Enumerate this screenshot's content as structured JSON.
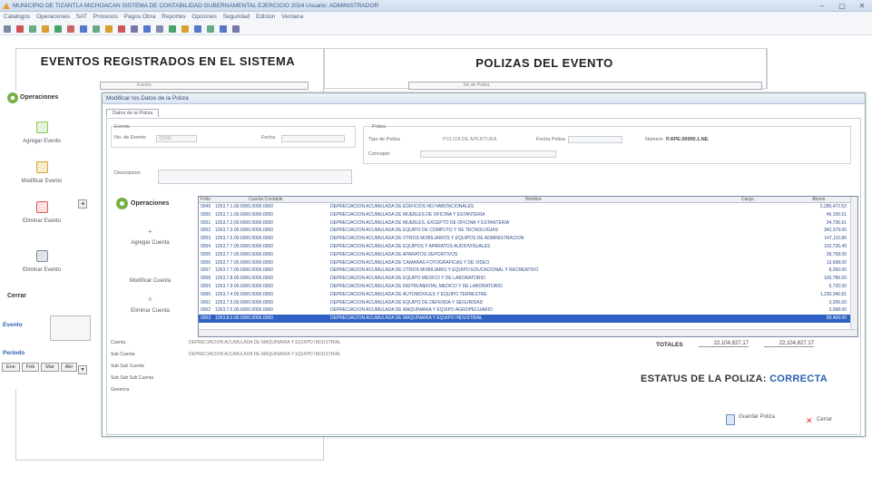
{
  "window": {
    "title": "MUNICIPIO DE TIZANTLA MICHOACAN SISTEMA DE CONTABILIDAD GUBERNAMENTAL EJERCICIO 2024 Usuario: ADMINISTRADOR",
    "controls": [
      "‒",
      "▢",
      "✕"
    ]
  },
  "menu": [
    "Catalogos",
    "Operaciones",
    "SAT",
    "Procesos",
    "Pagos Obra",
    "Reportes",
    "Opciones",
    "Seguridad",
    "Edicion",
    "Ventana"
  ],
  "toolbar_colors": [
    "#7a8aa0",
    "#c55",
    "#6a8",
    "#d8a030",
    "#4aa36a",
    "#c66",
    "#5577cc",
    "#6a8",
    "#d8a030",
    "#c55",
    "#77a",
    "#5577cc",
    "#88a",
    "#4aa36a",
    "#d8a030",
    "#5577cc",
    "#6a8",
    "#5577cc",
    "#77a"
  ],
  "background": {
    "left_header": "EVENTOS REGISTRADOS EN EL SISTEMA",
    "right_header": "POLIZAS DEL EVENTO",
    "combo_left": "Evento",
    "combo_right": "No de Poliza",
    "sidebar": {
      "title": "Operaciones",
      "buttons": [
        "Agregar Evento",
        "Modificar Evento",
        "Eliminar Evento",
        "Eliminar Evento"
      ],
      "cerrar": "Cerrar",
      "evento_label": "Evento",
      "periodo_label": "Periodo",
      "periodos": [
        "Ene",
        "Feb",
        "Mar",
        "Abr"
      ]
    }
  },
  "modal": {
    "title": "Modificar los Datos de la Poliza",
    "tab": "Datos de la Poliza",
    "evento_group": "Evento",
    "no_evento_label": "No. de Evento",
    "no_evento_value": "12345",
    "fecha_label": "Fecha",
    "poliza_group": "Poliza",
    "tipo_label": "Tipo de Poliza",
    "tipo_value": "POLIZA DE APERTURA",
    "fecha_poliza_label": "Fecha Poliza",
    "numero_label": "Numero",
    "numero_value": "P.APE.00000.1.NE",
    "concepto_label": "Concepto",
    "descripcion_label": "Descripcion",
    "operaciones": "Operaciones",
    "buttons": [
      "Agregar Cuenta",
      "Modificar Cuenta",
      "Eliminar Cuenta"
    ],
    "grid": {
      "headers": [
        "Folio",
        "Cuenta Contable",
        "Nombre",
        "Cargo",
        "Abono"
      ],
      "rows": [
        [
          "0049",
          "1263.7.1.00.0000.0000.0000",
          "DEPRECIACION ACUMULADA DE EDIFICIOS NO HABITACIONALES",
          "",
          "2,285,472.52"
        ],
        [
          "0050",
          "1263.7.1.00.0000.0000.0000",
          "DEPRECIACION ACUMULADA DE MUEBLES DE OFICINA Y ESTANTERIA",
          "",
          "46,156.51"
        ],
        [
          "0051",
          "1263.7.2.00.0000.0000.0000",
          "DEPRECIACION ACUMULADA DE MUEBLES, EXCEPTO DE OFICINA Y ESTANTERIA",
          "",
          "34,736.61"
        ],
        [
          "0052",
          "1263.7.3.00.0000.0000.0000",
          "DEPRECIACION ACUMULADA DE EQUIPO DE COMPUTO Y DE TECNOLOGIAS",
          "",
          "342,379.00"
        ],
        [
          "0053",
          "1263.7.5.00.0000.0000.0000",
          "DEPRECIACION ACUMULADA DE OTROS MOBILIARIOS Y EQUIPOS DE ADMINISTRACION",
          "",
          "147,110.80"
        ],
        [
          "0054",
          "1263.7.7.00.0000.0000.0000",
          "DEPRECIACION ACUMULADA DE EQUIPOS Y APARATOS AUDIOVISUALES",
          "",
          "102,726.49"
        ],
        [
          "0055",
          "1263.7.7.00.0000.0000.0000",
          "DEPRECIACION ACUMULADA DE APARATOS DEPORTIVOS",
          "",
          "39,758.00"
        ],
        [
          "0056",
          "1263.7.7.00.0000.0000.0000",
          "DEPRECIACION ACUMULADA DE CAMARAS FOTOGRAFICAS Y DE VIDEO",
          "",
          "13,668.00"
        ],
        [
          "0057",
          "1263.7.7.00.0000.0000.0000",
          "DEPRECIACION ACUMULADA DE OTROS MOBILIARIO Y EQUIPO EDUCACIONAL Y RECREATIVO",
          "",
          "8,050.00"
        ],
        [
          "0058",
          "1263.7.8.00.0000.0000.0000",
          "DEPRECIACION ACUMULADA DE EQUIPO MEDICO Y DE LABORATORIO",
          "",
          "100,786.00"
        ],
        [
          "0059",
          "1263.7.9.00.0000.0000.0000",
          "DEPRECIACION ACUMULADA DE INSTRUMENTAL MEDICO Y DE LABORATORIO",
          "",
          "6,720.00"
        ],
        [
          "0060",
          "1263.7.4.00.0000.0000.0000",
          "DEPRECIACION ACUMULADA DE AUTOMOVILES Y EQUIPO TERRESTRE",
          "",
          "1,230,340.81"
        ],
        [
          "0061",
          "1263.7.5.00.0000.0000.0000",
          "DEPRECIACION ACUMULADA DE EQUIPO DE DEFENSA Y SEGURIDAD",
          "",
          "3,206.00"
        ],
        [
          "0062",
          "1263.7.6.00.0000.0000.0000",
          "DEPRECIACION ACUMULADA DE MAQUINARIA Y EQUIPO AGROPECUARIO",
          "",
          "3,068.00"
        ],
        [
          "0063",
          "1263.8.0.00.0000.0000.0000",
          "DEPRECIACION ACUMULADA DE MAQUINARIA Y EQUIPO INDUSTRIAL",
          "",
          "99,400.00"
        ]
      ],
      "selected_row": 14
    },
    "totales_label": "TOTALES",
    "total_cargo": "22,104,827.17",
    "total_abono": "22,104,827.17",
    "estatus_label": "ESTATUS DE LA POLIZA:",
    "estatus_value": "CORRECTA",
    "bottom": {
      "cuenta_label": "Cuenta",
      "cuenta_value": "DEPRECIACION ACUMULADA DE MAQUINARIA Y EQUIPO INDUSTRIAL",
      "subcuenta_label": "Sub Cuenta",
      "subcuenta_value": "DEPRECIACION ACUMULADA DE MAQUINARIA Y EQUIPO INDUSTRIAL",
      "subsub_label": "Sub Sub Cuenta",
      "subsubsub_label": "Sub Sub Sub Cuenta",
      "generica_label": "Generica"
    },
    "guardar_label": "Guardar Poliza",
    "cerrar_label": "Cerrar"
  }
}
